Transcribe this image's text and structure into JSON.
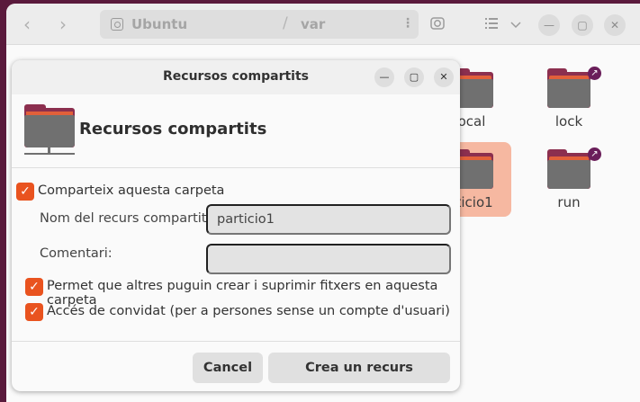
{
  "files_window": {
    "path": {
      "root": "Ubuntu",
      "separator": "/",
      "current": "var"
    },
    "more_icon": "⋮",
    "items": [
      {
        "label": "ocal",
        "link": false
      },
      {
        "label": "lock",
        "link": true
      },
      {
        "label": "rticio1",
        "link": false
      },
      {
        "label": "run",
        "link": true
      }
    ]
  },
  "dialog": {
    "title": "Recursos compartits",
    "heading": "Recursos compartits",
    "share_checkbox": {
      "label": "Comparteix aquesta carpeta",
      "checked": true
    },
    "share_name": {
      "label": "Nom del recurs compartit:",
      "value": "particio1"
    },
    "comment": {
      "label": "Comentari:",
      "value": ""
    },
    "allow_others": {
      "label": "Permet que altres puguin crear i suprimir fitxers en aquesta carpeta",
      "checked": true
    },
    "guest_access": {
      "label": "Accés de convidat (per a persones sense un compte d'usuari)",
      "checked": true
    },
    "cancel_label": "Cancel",
    "create_label": "Crea un recurs compartit"
  },
  "colors": {
    "accent": "#e9531f",
    "folder_back": "#8c2f4f",
    "folder_front": "#707070",
    "selection": "#f6b8a1",
    "link_badge": "#6a1e5a"
  }
}
